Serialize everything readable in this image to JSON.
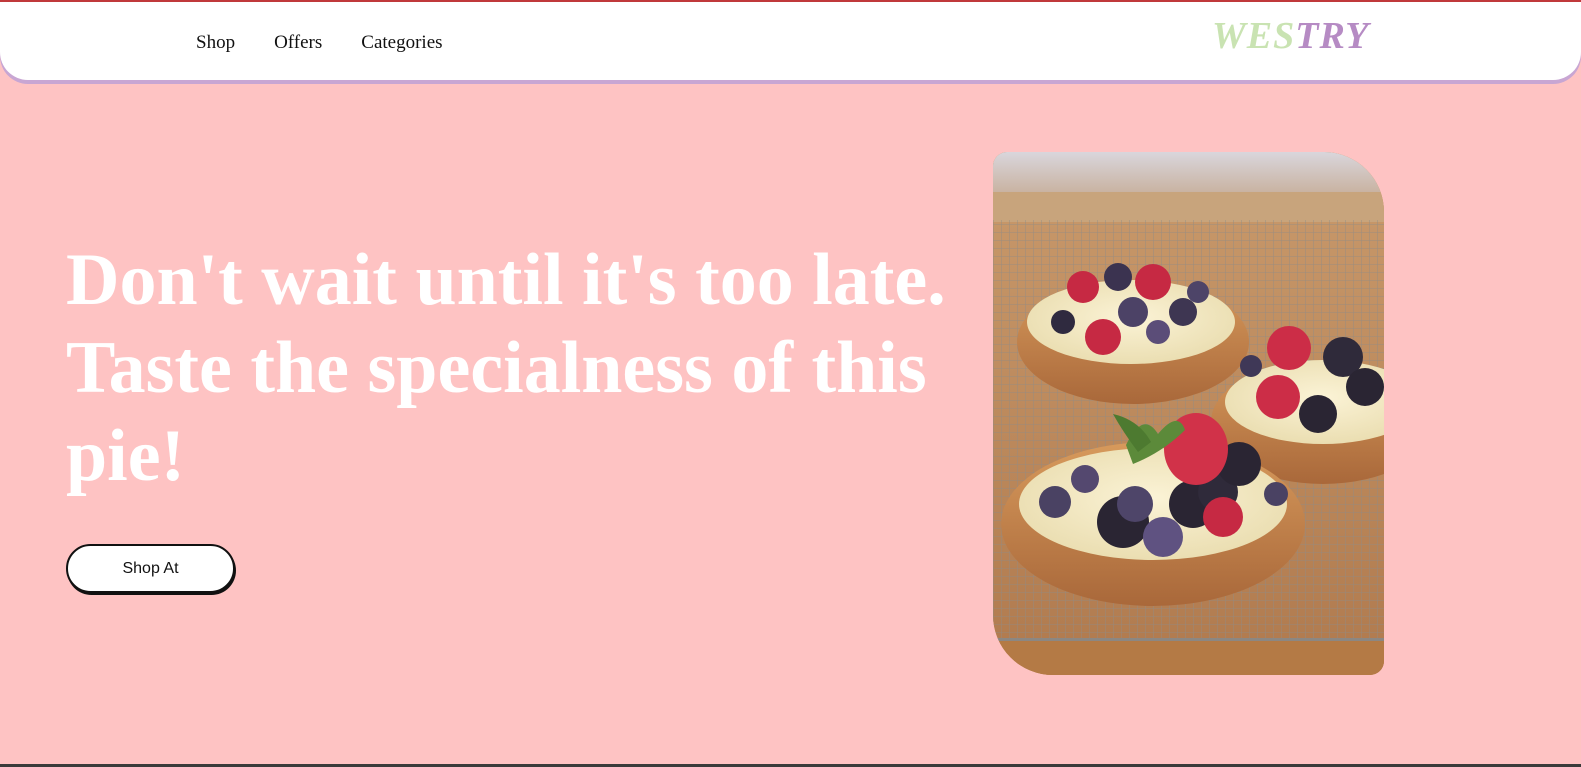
{
  "nav": {
    "links": [
      "Shop",
      "Offers",
      "Categories"
    ],
    "logo": {
      "part1": "WES",
      "part2": "TRY"
    }
  },
  "hero": {
    "title": "Don't wait until it's too late. Taste the specialness of this pie!",
    "button_label": "Shop At",
    "image": "berry-tart-photo"
  },
  "colors": {
    "background": "#fec3c3",
    "logo_green": "#c9e3b2",
    "logo_purple": "#b68bc4",
    "nav_shadow": "#c8a6d3"
  }
}
